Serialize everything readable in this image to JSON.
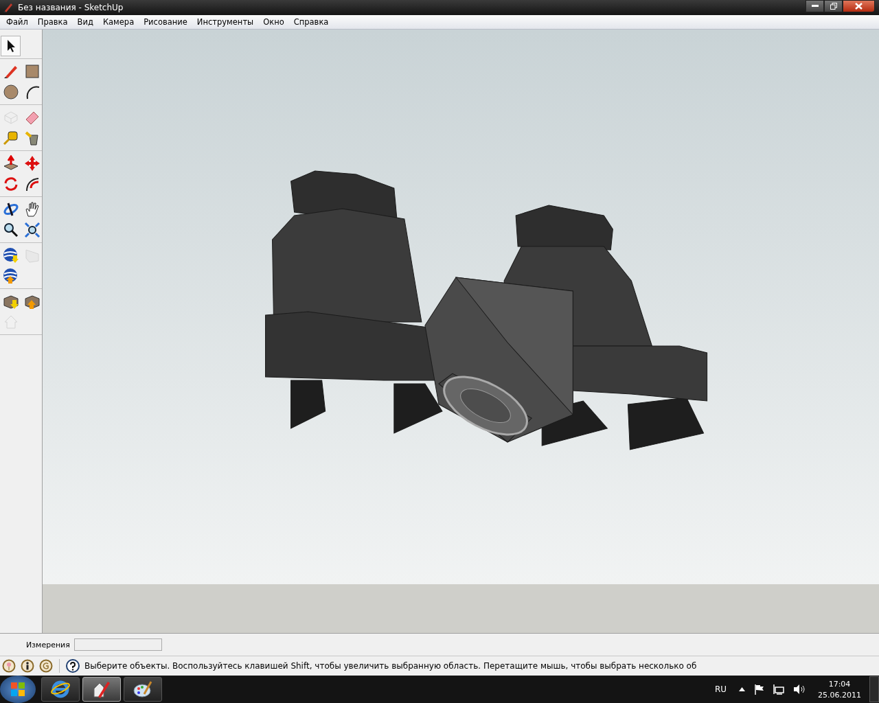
{
  "window": {
    "title": "Без названия - SketchUp"
  },
  "menu": [
    "Файл",
    "Правка",
    "Вид",
    "Камера",
    "Рисование",
    "Инструменты",
    "Окно",
    "Справка"
  ],
  "toolbar": {
    "groups": [
      {
        "tools": [
          {
            "kind": "select",
            "selected": true,
            "disabled": false
          }
        ]
      },
      {
        "tools": [
          {
            "kind": "pencil",
            "selected": false,
            "disabled": false
          },
          {
            "kind": "rectangle",
            "selected": false,
            "disabled": false
          },
          {
            "kind": "circle",
            "selected": false,
            "disabled": false
          },
          {
            "kind": "arc",
            "selected": false,
            "disabled": false
          }
        ]
      },
      {
        "tools": [
          {
            "kind": "component",
            "selected": false,
            "disabled": true
          },
          {
            "kind": "eraser",
            "selected": false,
            "disabled": false
          },
          {
            "kind": "tape",
            "selected": false,
            "disabled": false
          },
          {
            "kind": "bucket",
            "selected": false,
            "disabled": false
          }
        ]
      },
      {
        "tools": [
          {
            "kind": "pushpull",
            "selected": false,
            "disabled": false
          },
          {
            "kind": "move",
            "selected": false,
            "disabled": false
          },
          {
            "kind": "rotate",
            "selected": false,
            "disabled": false
          },
          {
            "kind": "followme",
            "selected": false,
            "disabled": false
          }
        ]
      },
      {
        "tools": [
          {
            "kind": "orbit",
            "selected": false,
            "disabled": false
          },
          {
            "kind": "pan",
            "selected": false,
            "disabled": false
          },
          {
            "kind": "zoom",
            "selected": false,
            "disabled": false
          },
          {
            "kind": "zoomextents",
            "selected": false,
            "disabled": false
          }
        ]
      },
      {
        "tools": [
          {
            "kind": "globedown",
            "selected": false,
            "disabled": false
          },
          {
            "kind": "share",
            "selected": false,
            "disabled": true
          },
          {
            "kind": "globeup",
            "selected": false,
            "disabled": false
          }
        ]
      },
      {
        "tools": [
          {
            "kind": "boxdown",
            "selected": false,
            "disabled": false
          },
          {
            "kind": "boxup",
            "selected": false,
            "disabled": false
          },
          {
            "kind": "house",
            "selected": false,
            "disabled": true
          }
        ]
      }
    ]
  },
  "measurements": {
    "label": "Измерения"
  },
  "status_bar": {
    "message": "Выберите объекты. Воспользуйтесь клавишей Shift, чтобы увеличить выбранную область. Перетащите мышь, чтобы выбрать несколько об"
  },
  "taskbar": {
    "apps": [
      {
        "kind": "ie",
        "selected": false
      },
      {
        "kind": "sketchup",
        "selected": true
      },
      {
        "kind": "paint",
        "selected": false
      }
    ],
    "language": "RU",
    "time": "17:04",
    "date": "25.06.2011"
  }
}
